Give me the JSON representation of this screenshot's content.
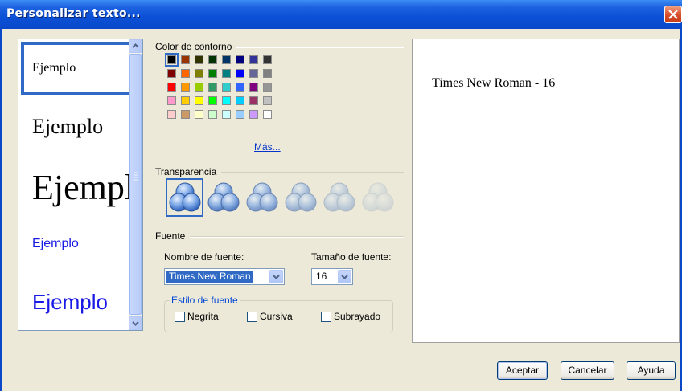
{
  "window": {
    "title": "Personalizar texto..."
  },
  "samples": [
    {
      "label": "Ejemplo",
      "font": "serif",
      "size": 16,
      "color": "#000000"
    },
    {
      "label": "Ejemplo",
      "font": "serif",
      "size": 26,
      "color": "#000000"
    },
    {
      "label": "Ejemplo",
      "font": "serif",
      "size": 44,
      "color": "#000000"
    },
    {
      "label": "Ejemplo",
      "font": "sans",
      "size": 16,
      "color": "#1a1ae6"
    },
    {
      "label": "Ejemplo",
      "font": "sans",
      "size": 26,
      "color": "#1a1ae6"
    }
  ],
  "outline_color": {
    "heading": "Color de contorno",
    "more_link": "Más...",
    "selected": "#000000",
    "palette": [
      [
        "#000000",
        "#993300",
        "#333300",
        "#003300",
        "#003366",
        "#000080",
        "#333399",
        "#333333"
      ],
      [
        "#800000",
        "#ff6600",
        "#808000",
        "#008000",
        "#008080",
        "#0000ff",
        "#666699",
        "#808080"
      ],
      [
        "#ff0000",
        "#ff9900",
        "#99cc00",
        "#339966",
        "#33cccc",
        "#3366ff",
        "#800080",
        "#969696"
      ],
      [
        "#ff99cc",
        "#ffcc00",
        "#ffff00",
        "#00ff00",
        "#00ffff",
        "#00ccff",
        "#993366",
        "#c0c0c0"
      ],
      [
        "#ffcccc",
        "#cc9966",
        "#ffffcc",
        "#ccffcc",
        "#ccffff",
        "#99ccff",
        "#cc99ff",
        "#ffffff"
      ]
    ]
  },
  "transparency": {
    "heading": "Transparencia",
    "levels": [
      0,
      20,
      40,
      60,
      80,
      100
    ],
    "selected_index": 0
  },
  "font": {
    "heading": "Fuente",
    "name_label": "Nombre de fuente:",
    "name_value": "Times New Roman",
    "size_label": "Tamaño de fuente:",
    "size_value": "16",
    "style_heading": "Estilo de fuente",
    "bold_label": "Negrita",
    "italic_label": "Cursiva",
    "underline_label": "Subrayado",
    "bold": false,
    "italic": false,
    "underline": false
  },
  "preview": {
    "text": "Times New Roman - 16"
  },
  "buttons": {
    "ok": "Aceptar",
    "cancel": "Cancelar",
    "help": "Ayuda"
  },
  "colors": {
    "accent": "#316ac5",
    "titlebar": "#0b50d6",
    "group_heading": "#0046d5"
  }
}
